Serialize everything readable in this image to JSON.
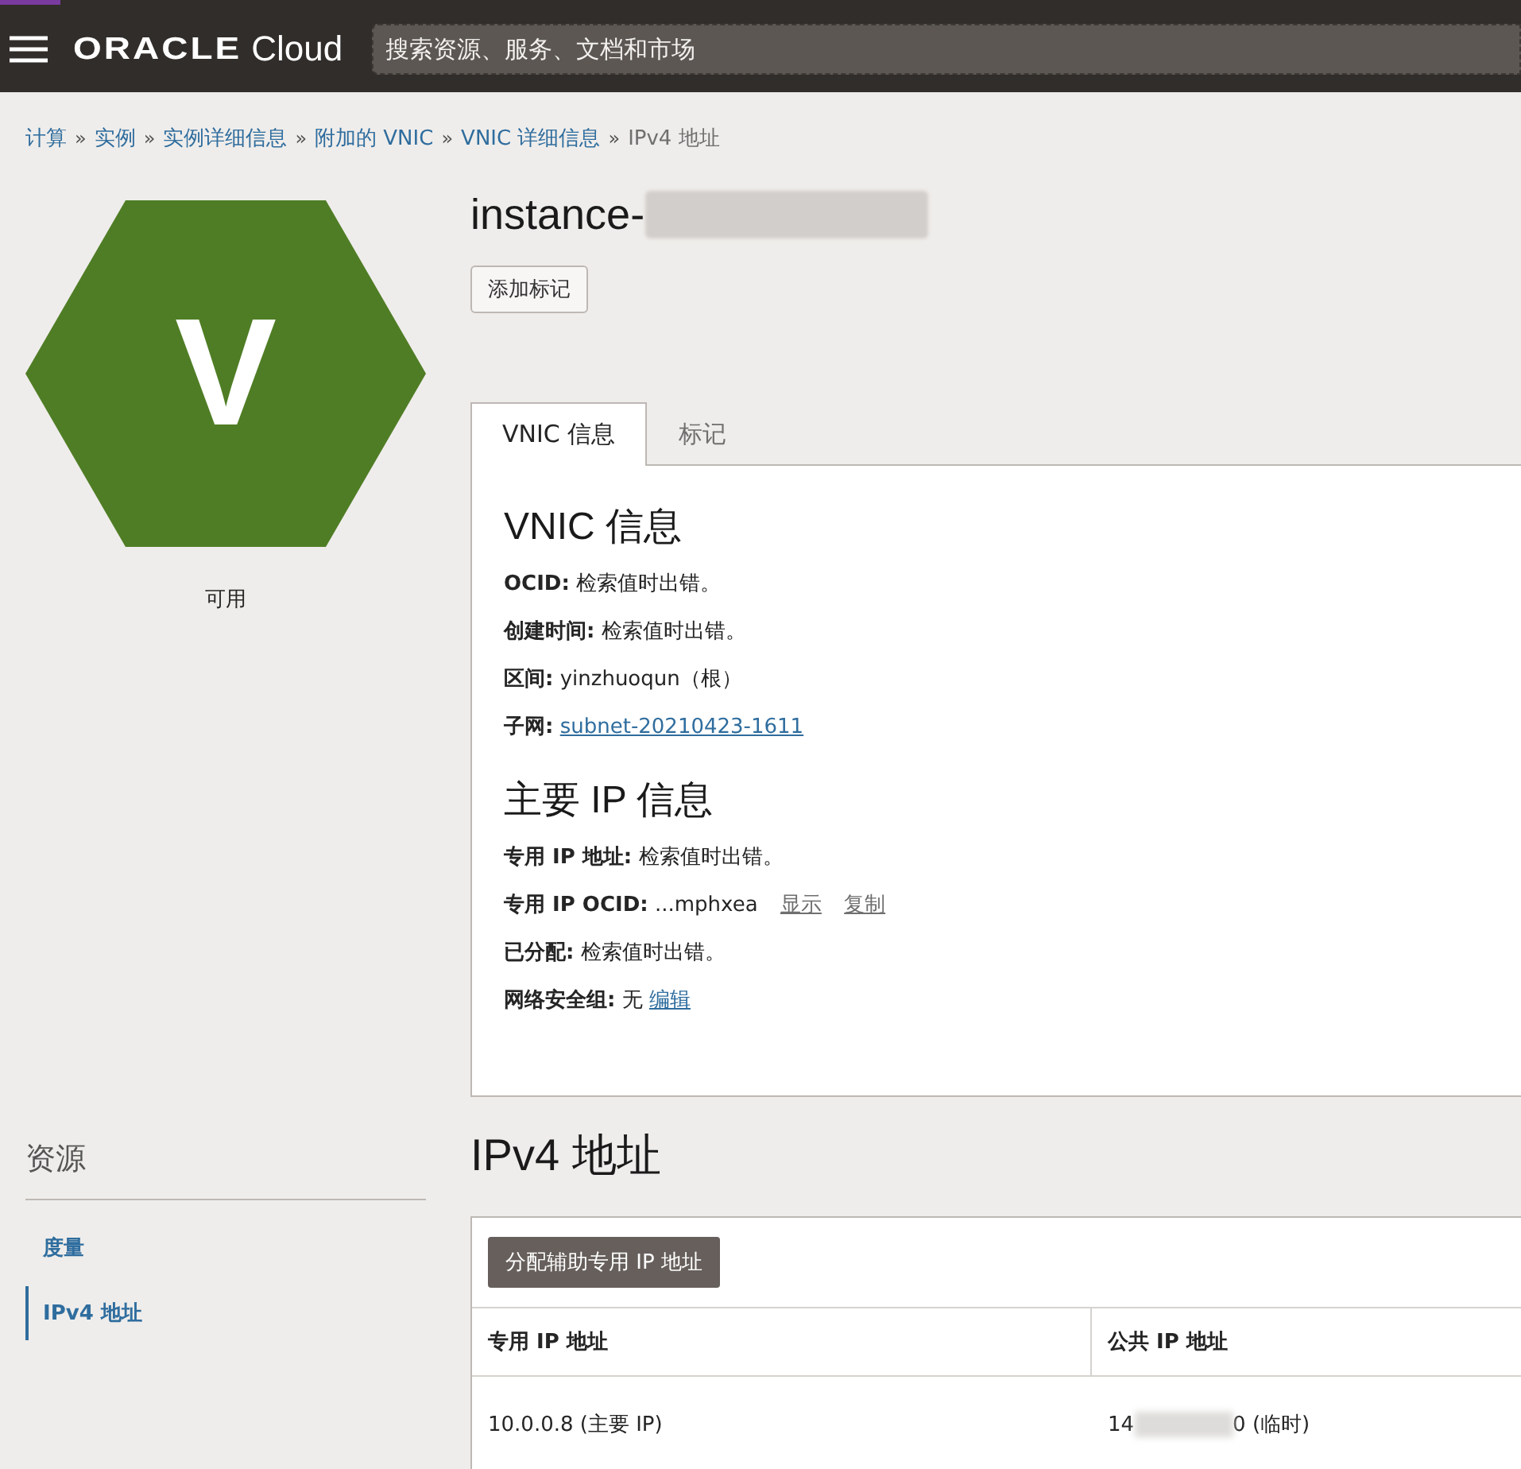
{
  "header": {
    "brand": "ORACLE",
    "product": "Cloud",
    "search": {
      "placeholder": "搜索资源、服务、文档和市场"
    }
  },
  "breadcrumb": [
    {
      "label": "计算",
      "sep": "»",
      "current": false
    },
    {
      "label": "实例",
      "sep": "»",
      "current": false
    },
    {
      "label": "实例详细信息",
      "sep": "»",
      "current": false
    },
    {
      "label": "附加的 VNIC",
      "sep": "»",
      "current": false
    },
    {
      "label": "VNIC 详细信息",
      "sep": "»",
      "current": false
    },
    {
      "label": "IPv4 地址",
      "current": true
    }
  ],
  "status": {
    "letter": "V",
    "label": "可用"
  },
  "resources": {
    "title": "资源",
    "items": [
      {
        "label": "度量",
        "selected": false
      },
      {
        "label": "IPv4 地址",
        "selected": true
      }
    ]
  },
  "title": "instance-",
  "add_tag_button": "添加标记",
  "tabs": [
    {
      "label": "VNIC 信息",
      "selected": true
    },
    {
      "label": "标记",
      "selected": false
    }
  ],
  "sections": [
    {
      "heading": "VNIC 信息",
      "fields": [
        {
          "label": "OCID:",
          "value": "检索值时出错。"
        },
        {
          "label": "创建时间:",
          "value": "检索值时出错。"
        },
        {
          "label": "区间:",
          "value": "yinzhuoqun（根）"
        },
        {
          "label": "子网:",
          "links": [
            {
              "text": "subnet-20210423-1611",
              "kind": "link"
            }
          ]
        }
      ]
    },
    {
      "heading": "主要 IP 信息",
      "fields": [
        {
          "label": "专用 IP 地址:",
          "value": "检索值时出错。"
        },
        {
          "label": "专用 IP OCID:",
          "value": "...mphxea",
          "links": [
            {
              "text": "显示",
              "kind": "action"
            },
            {
              "text": "复制",
              "kind": "action"
            }
          ]
        },
        {
          "label": "已分配:",
          "value": "检索值时出错。"
        },
        {
          "label": "网络安全组:",
          "value": "无",
          "links": [
            {
              "text": "编辑",
              "kind": "link"
            }
          ]
        }
      ]
    }
  ],
  "ipv4": {
    "heading": "IPv4 地址",
    "button": "分配辅助专用 IP 地址",
    "columns": [
      "专用 IP 地址",
      "公共 IP 地址"
    ],
    "rows": [
      {
        "private_ip": "10.0.0.8 (主要 IP)",
        "public_ip_start": "14",
        "public_ip_end": "0 (临时)"
      }
    ]
  }
}
